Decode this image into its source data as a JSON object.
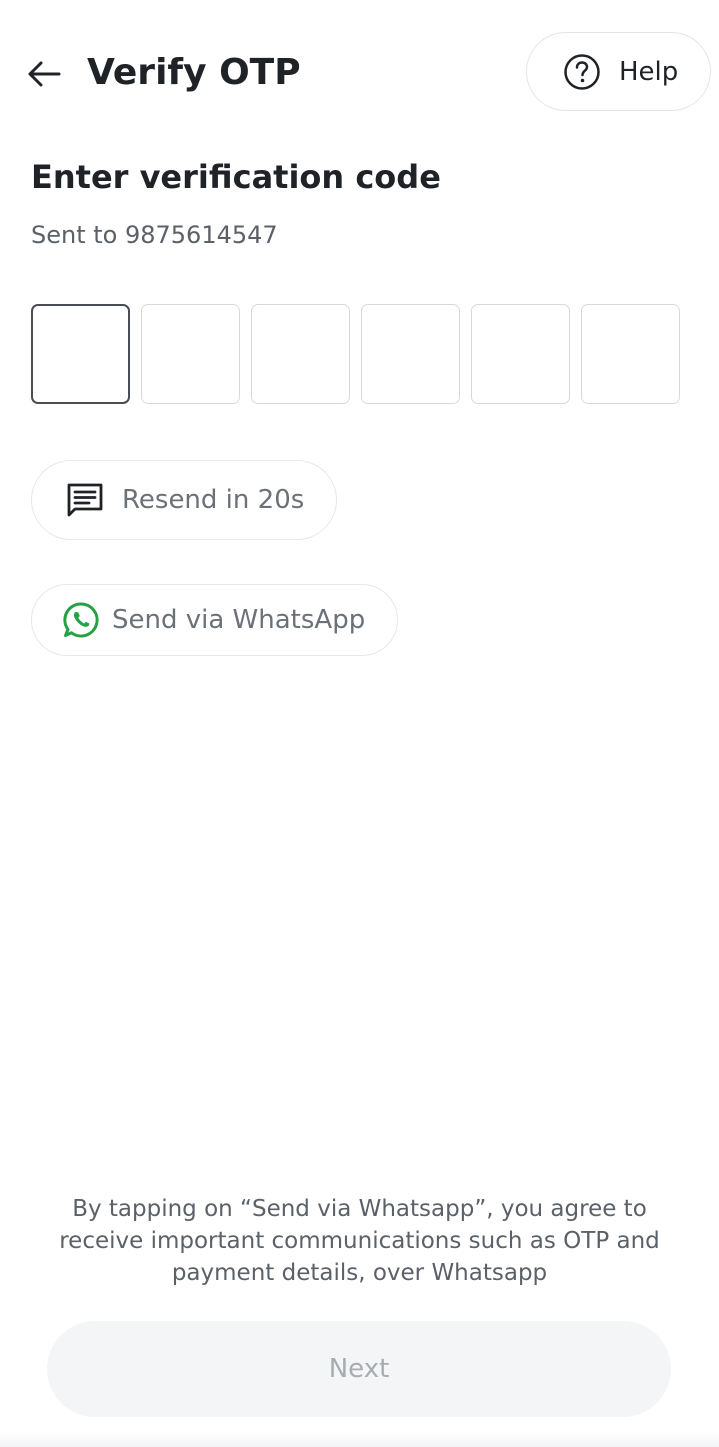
{
  "header": {
    "title": "Verify OTP",
    "help_label": "Help"
  },
  "verification": {
    "heading": "Enter verification code",
    "sent_to": "Sent to 9875614547",
    "otp_length": 6,
    "otp_values": [
      "",
      "",
      "",
      "",
      "",
      ""
    ]
  },
  "actions": {
    "resend_label": "Resend in 20s",
    "whatsapp_label": "Send via WhatsApp"
  },
  "footer": {
    "consent_text": "By tapping on “Send via Whatsapp”, you agree to receive important communications such as OTP and payment details, over Whatsapp",
    "next_label": "Next"
  },
  "colors": {
    "whatsapp_green": "#25a244",
    "text_primary": "#1f2328",
    "text_muted": "#6b7178",
    "disabled_button_bg": "#f4f5f7"
  },
  "icons": {
    "back": "arrow-left-icon",
    "help": "question-circle-icon",
    "resend": "message-icon",
    "whatsapp": "whatsapp-icon"
  }
}
